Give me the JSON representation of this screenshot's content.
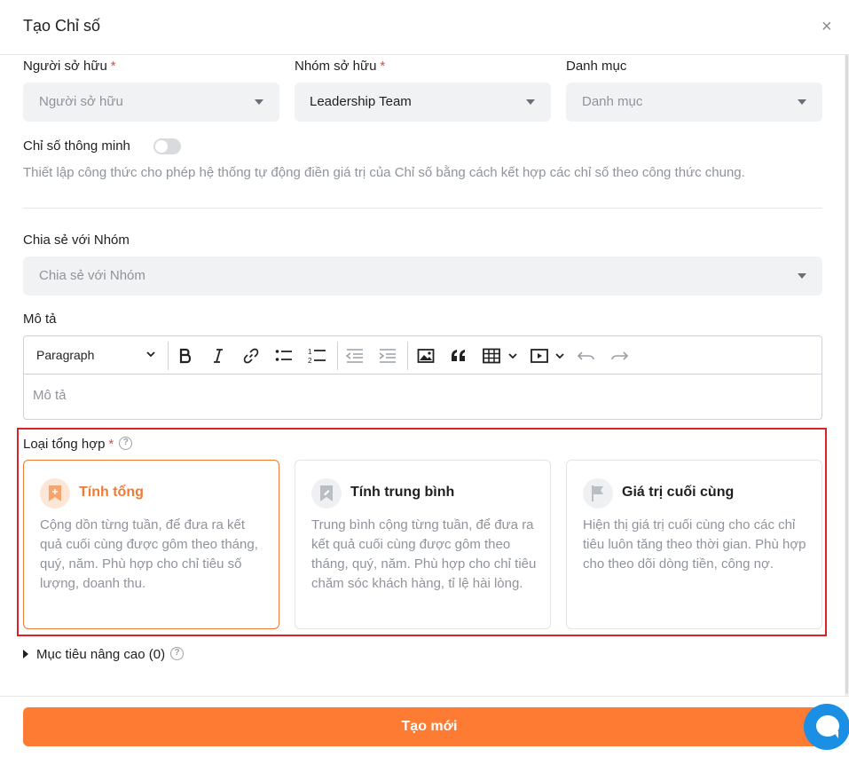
{
  "dialog": {
    "title": "Tạo Chỉ số",
    "close_label": "×"
  },
  "owner": {
    "label": "Người sở hữu",
    "required_mark": "*",
    "placeholder": "Người sở hữu"
  },
  "owner_group": {
    "label": "Nhóm sở hữu",
    "required_mark": "*",
    "value": "Leadership Team"
  },
  "category": {
    "label": "Danh mục",
    "placeholder": "Danh mục"
  },
  "smart_metric": {
    "label": "Chỉ số thông minh",
    "enabled": false,
    "description": "Thiết lập công thức cho phép hệ thống tự động điền giá trị của Chỉ số bằng cách kết hợp các chỉ số theo công thức chung."
  },
  "share_group": {
    "label": "Chia sẻ với Nhóm",
    "placeholder": "Chia sẻ với Nhóm"
  },
  "description": {
    "label": "Mô tả",
    "placeholder": "Mô tả",
    "toolbar": {
      "block_format": "Paragraph"
    }
  },
  "aggregation": {
    "label": "Loại tổng hợp",
    "required_mark": "*",
    "help_icon": "?",
    "options": [
      {
        "title": "Tính tổng",
        "icon": "bookmark-plus-icon",
        "selected": true,
        "description": "Cộng dồn từng tuần, để đưa ra kết quả cuối cùng được gôm theo tháng, quý, năm. Phù hợp cho chỉ tiêu số lượng, doanh thu."
      },
      {
        "title": "Tính trung bình",
        "icon": "bookmark-icon",
        "selected": false,
        "description": "Trung bình cộng từng tuần, để đưa ra kết quả cuối cùng được gôm theo tháng, quý, năm. Phù hợp cho chỉ tiêu chăm sóc khách hàng, tỉ lệ hài lòng."
      },
      {
        "title": "Giá trị cuối cùng",
        "icon": "flag-icon",
        "selected": false,
        "description": "Hiện thị giá trị cuối cùng cho các chỉ tiêu luôn tăng theo thời gian. Phù hợp cho theo dõi dòng tiền, công nợ."
      }
    ]
  },
  "advanced_goals": {
    "label": "Mục tiêu nâng cao (0)",
    "help_icon": "?"
  },
  "footer": {
    "create_label": "Tạo mới"
  },
  "colors": {
    "accent": "#fd7b32",
    "highlight_border": "#d8232a",
    "chat": "#1a8fe3"
  }
}
